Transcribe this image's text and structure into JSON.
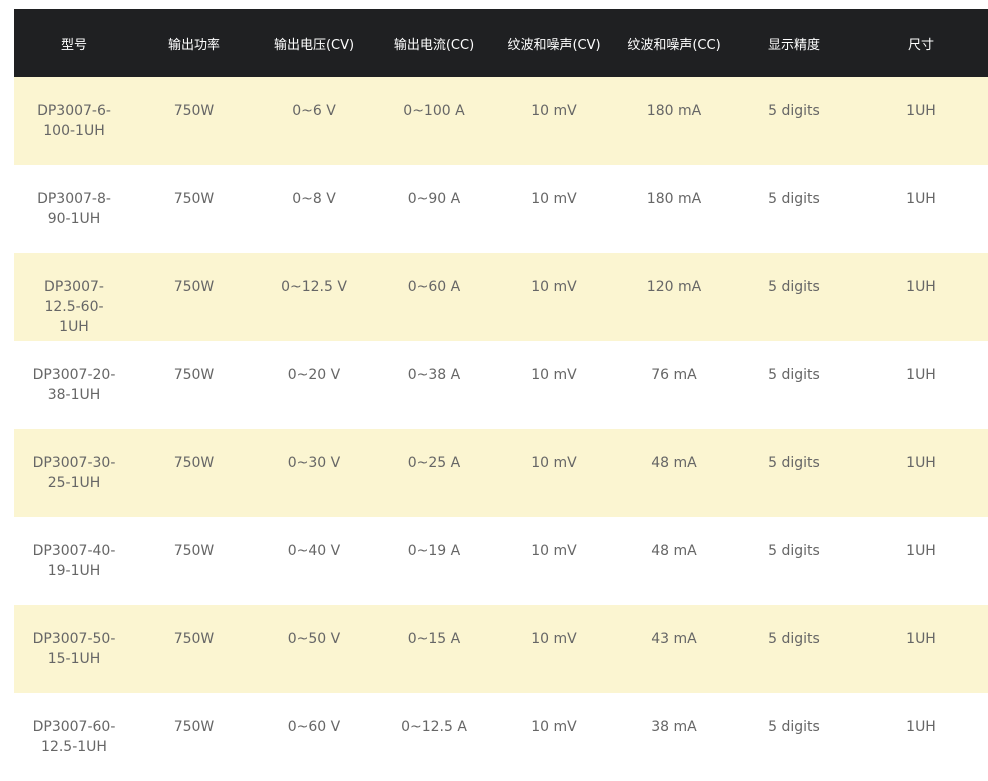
{
  "table": {
    "headers": [
      "型号",
      "输出功率",
      "输出电压(CV)",
      "输出电流(CC)",
      "纹波和噪声(CV)",
      "纹波和噪声(CC)",
      "显示精度",
      "尺寸"
    ],
    "rows": [
      [
        "DP3007-6-100-1UH",
        "750W",
        "0~6 V",
        "0~100 A",
        "10 mV",
        "180 mA",
        "5 digits",
        "1UH"
      ],
      [
        "DP3007-8-90-1UH",
        "750W",
        "0~8 V",
        "0~90 A",
        "10 mV",
        "180 mA",
        "5 digits",
        "1UH"
      ],
      [
        "DP3007-12.5-60-1UH",
        "750W",
        "0~12.5 V",
        "0~60 A",
        "10 mV",
        "120 mA",
        "5 digits",
        "1UH"
      ],
      [
        "DP3007-20-38-1UH",
        "750W",
        "0~20 V",
        "0~38 A",
        "10 mV",
        "76 mA",
        "5 digits",
        "1UH"
      ],
      [
        "DP3007-30-25-1UH",
        "750W",
        "0~30 V",
        "0~25 A",
        "10 mV",
        "48 mA",
        "5 digits",
        "1UH"
      ],
      [
        "DP3007-40-19-1UH",
        "750W",
        "0~40 V",
        "0~19 A",
        "10 mV",
        "48 mA",
        "5 digits",
        "1UH"
      ],
      [
        "DP3007-50-15-1UH",
        "750W",
        "0~50 V",
        "0~15 A",
        "10 mV",
        "43 mA",
        "5 digits",
        "1UH"
      ],
      [
        "DP3007-60-12.5-1UH",
        "750W",
        "0~60 V",
        "0~12.5 A",
        "10 mV",
        "38 mA",
        "5 digits",
        "1UH"
      ]
    ]
  },
  "colors": {
    "header_bg": "#1f2022",
    "header_text": "#ffffff",
    "row_odd_bg": "#fbf5d1",
    "row_even_bg": "#ffffff",
    "cell_text": "#666666"
  }
}
